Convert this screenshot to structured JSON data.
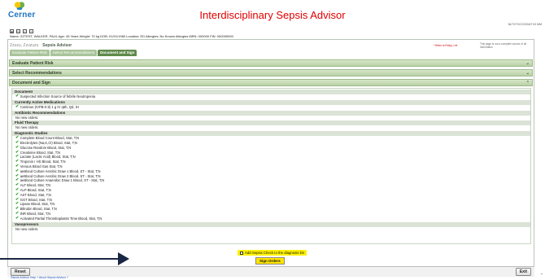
{
  "header": {
    "logo_text": "Cerner",
    "title": "Interdisciplinary Sepsis Advisor",
    "right_text": "NLTGTGCGOOIAT 00 MM"
  },
  "toolbar": {
    "icons": [
      "save-icon",
      "refresh-icon",
      "print-icon",
      "help-icon"
    ]
  },
  "patient_banner": "Name: ZZTEST, WALKER, PAUL    Age: 45 Years    Weight: 70 kg    DOB: 01/01/1980    Location: ED    Allergies: No Known Allergies    MRN: 000000    FIN: 000000000",
  "subheader": {
    "patient_label": "Zzuzu, Zzuzuzu",
    "app_name": "Sepsis Advisor",
    "note_red": "* Refer to Policy / ref",
    "note": "This page is not a complete source of all information"
  },
  "tabs": [
    "Evaluate Patient Risk",
    "Select Recommendations",
    "Document and Sign"
  ],
  "sections": [
    "Evaluate Patient Risk",
    "Select Recommendations",
    "Document and Sign"
  ],
  "content": {
    "document_header": "Document",
    "document_items": [
      "Suspected Infection Source of febrile Neutropenia"
    ],
    "active_meds_header": "Currently Active Medications",
    "active_meds_items": [
      "Continue (IVPB-0.9) 1 g IV q6h, Qd, IH"
    ],
    "antibiotic_header": "Antibiotic Recommendations",
    "antibiotic_note": "No new orders.",
    "fluid_header": "Fluid Therapy",
    "fluid_note": "No new orders.",
    "diagnostic_header": "Diagnostic Studies",
    "diagnostic_items": [
      "Complete Blood Count Blood, Stat, T;N",
      "Electrolytes (Na,K,Cl) Blood, Stat, T;N",
      "Glucose Random Blood, Stat, T;N",
      "Creatinine Blood, Stat, T;N",
      "Lactate (Lactic Acid) Blood, Stat, T;N",
      "Troponin I HS Blood, Stat, T;N",
      "Venous Blood Gas Stat, T;N",
      "aeBlood Culture Aerobic Draw 1 Blood, ST - Stat, T;N",
      "aeBlood Culture Aerobic Draw 2 Blood, ST - Stat, T;N",
      "aeBlood Culture Anaerobic Draw 1 Blood, ST - Stat, T;N",
      "ALT Blood, Stat, T;N",
      "ALP Blood, Stat, T;N",
      "AST Blood, Stat, T;N",
      "GGT Blood, Stat, T;N",
      "Lipase Blood, Stat, T;N",
      "Bilirubin Blood, Stat, T;N",
      "INR Blood, Stat, T;N",
      "Activated Partial Thromboplastin Time Blood, Stat, T;N"
    ],
    "vasopressors_header": "Vasopressors",
    "vasopressors_note": "No new orders."
  },
  "sepsis_checkbox_label": "Add Sepsis Check to the diagnosis list",
  "sign_button": "Sign Orders",
  "reset_button": "Reset",
  "exit_button": "Exit",
  "footer_links": "Sepsis Advisor Help ?   About Sepsis Advisor ?",
  "colors": {
    "title": "#e00000",
    "section": "#b9d1a6",
    "highlight": "#fff200",
    "check": "#1a9a1a"
  }
}
